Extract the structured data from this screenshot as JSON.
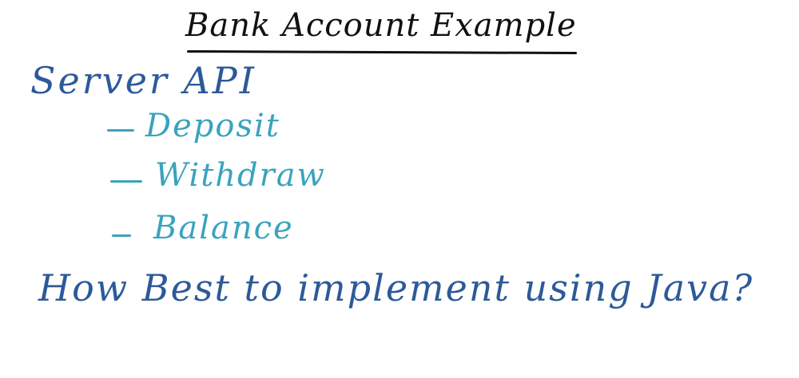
{
  "title": "Bank Account Example",
  "heading": "Server API",
  "items": [
    {
      "dash": "-",
      "label": "Deposit"
    },
    {
      "dash": "-",
      "label": "Withdraw"
    },
    {
      "dash": "-",
      "label": "Balance"
    }
  ],
  "question": "How Best to implement using Java?",
  "colors": {
    "title": "#111111",
    "heading": "#2c5a98",
    "items": "#3aa3bd",
    "question": "#2c5a98",
    "background": "#ffffff"
  }
}
